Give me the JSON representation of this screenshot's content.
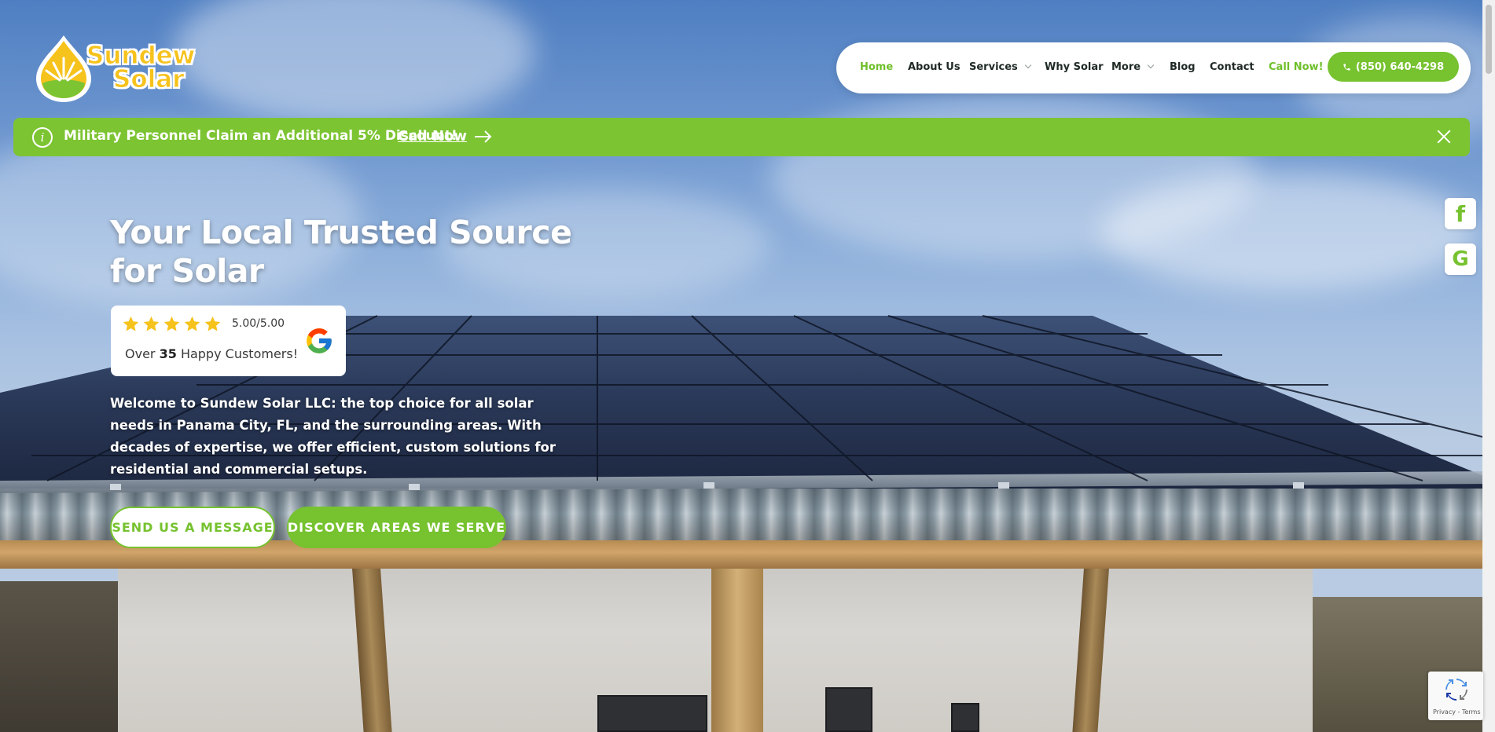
{
  "brand": {
    "name_line1": "Sundew",
    "name_line2": "Solar"
  },
  "nav": {
    "items": [
      {
        "label": "Home"
      },
      {
        "label": "About Us"
      },
      {
        "label": "Services"
      },
      {
        "label": "Why Solar"
      },
      {
        "label": "More"
      },
      {
        "label": "Blog"
      },
      {
        "label": "Contact"
      },
      {
        "label": "Call Now!"
      }
    ],
    "phone": "(850) 640-4298"
  },
  "announcement": {
    "text": "Military Personnel Claim an Additional 5% Discount!",
    "link": "Call Now"
  },
  "social": {
    "facebook": "f",
    "google": "G"
  },
  "hero": {
    "title": "Your Local Trusted Source for Solar",
    "review": {
      "rating": "5.00/5.00",
      "prefix": "Over",
      "count": "35",
      "suffix": "Happy Customers!",
      "stars": 5
    },
    "description": "Welcome to Sundew Solar LLC: the top choice for all solar needs in Panama City, FL, and the surrounding areas. With decades of expertise, we offer efficient, custom solutions for residential and commercial setups.",
    "buttons": {
      "primary": "SEND US A MESSAGE",
      "secondary": "DISCOVER AREAS WE SERVE"
    }
  },
  "recaptcha": {
    "text": "Privacy - Terms"
  },
  "colors": {
    "accent": "#76c22f",
    "announce": "#7cc432",
    "logo_yellow": "#f6c21c",
    "text_dark": "#1f2a24"
  }
}
